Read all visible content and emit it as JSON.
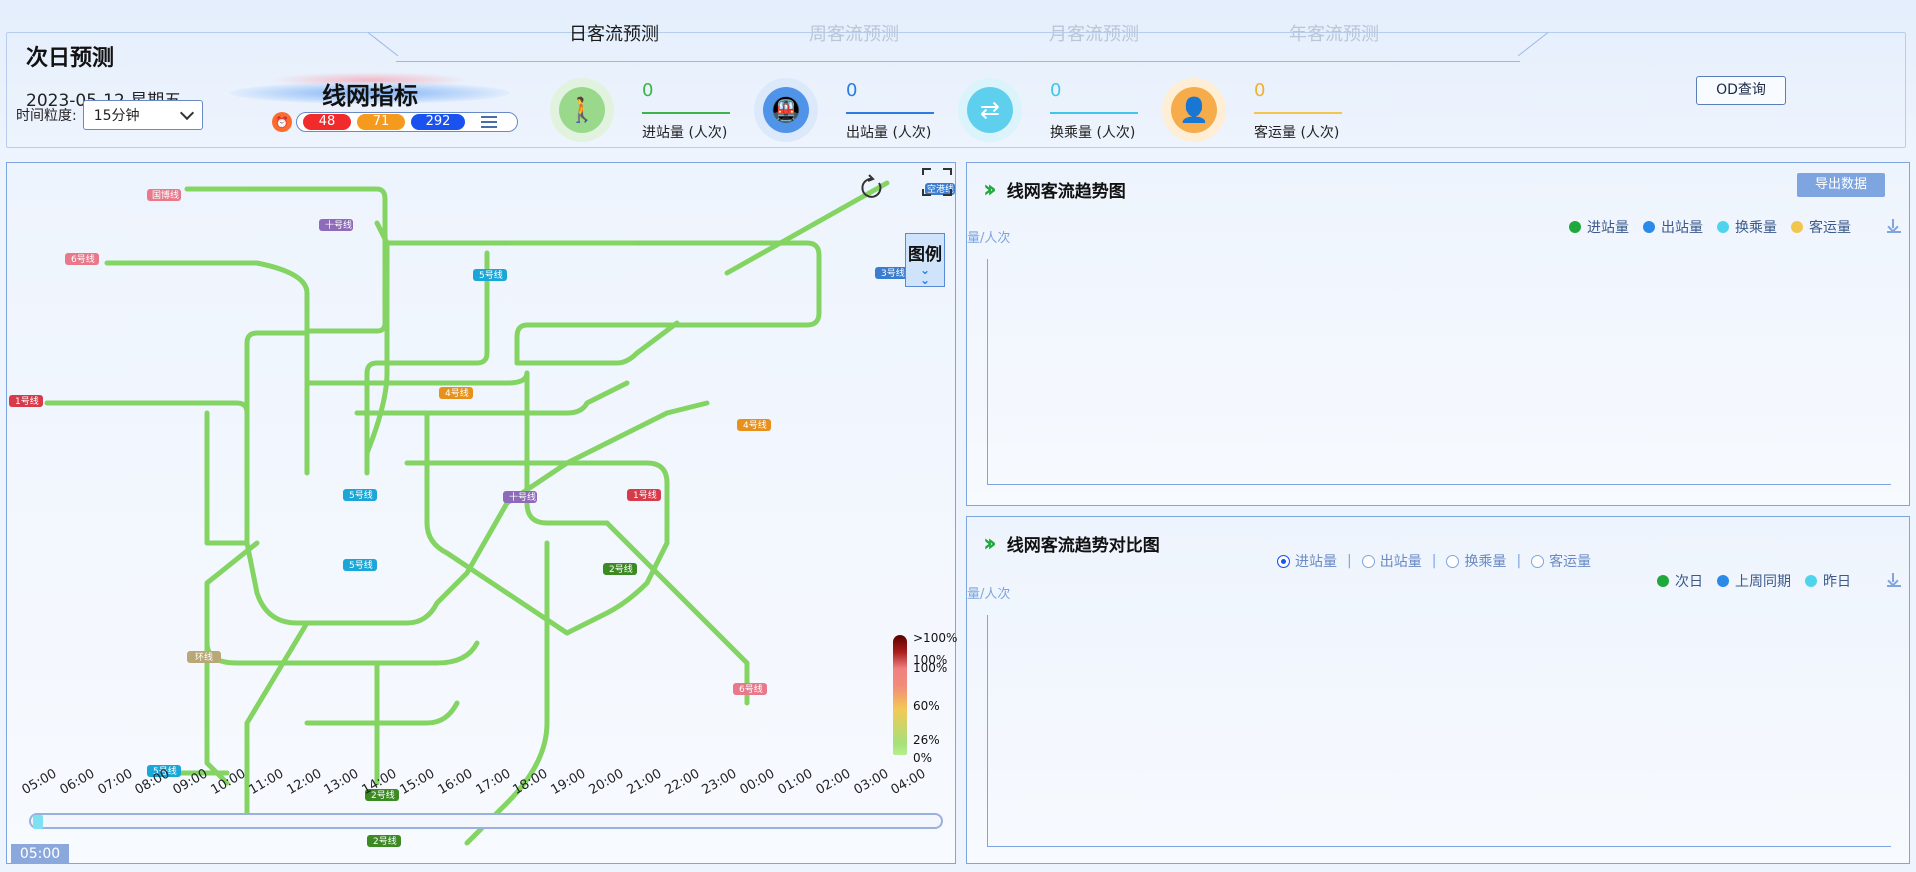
{
  "header": {
    "tabs": [
      {
        "label": "日客流预测",
        "active": true
      },
      {
        "label": "周客流预测",
        "active": false
      },
      {
        "label": "月客流预测",
        "active": false
      },
      {
        "label": "年客流预测",
        "active": false
      }
    ],
    "title": "次日预测",
    "date": "2023-05-12 星期五",
    "granularity_label": "时间粒度:",
    "granularity_value": "15分钟",
    "od_button": "OD查询"
  },
  "net_index": {
    "title": "线网指标",
    "badges": [
      {
        "value": "48",
        "color": "#f12b2b"
      },
      {
        "value": "71",
        "color": "#f59a1c"
      },
      {
        "value": "292",
        "color": "#1a52f0"
      }
    ]
  },
  "metrics": [
    {
      "value": "0",
      "label": "进站量 (人次)",
      "color": "#3bb44a",
      "icon": "walking-person-icon"
    },
    {
      "value": "0",
      "label": "出站量 (人次)",
      "color": "#2b7ce0",
      "icon": "train-icon"
    },
    {
      "value": "0",
      "label": "换乘量 (人次)",
      "color": "#3fc6ea",
      "icon": "transfer-arrows-icon"
    },
    {
      "value": "0",
      "label": "客运量 (人次)",
      "color": "#f2b12c",
      "icon": "person-icon"
    }
  ],
  "map": {
    "legend_button": "图例",
    "scale_labels": [
      ">100%",
      "100%",
      "100%",
      "60%",
      "26%",
      "0%"
    ],
    "time_ticks": [
      "05:00",
      "06:00",
      "07:00",
      "08:00",
      "09:00",
      "10:00",
      "11:00",
      "12:00",
      "13:00",
      "14:00",
      "15:00",
      "16:00",
      "17:00",
      "18:00",
      "19:00",
      "20:00",
      "21:00",
      "22:00",
      "23:00",
      "00:00",
      "01:00",
      "02:00",
      "03:00",
      "04:00"
    ],
    "current_time": "05:00",
    "line_tags": [
      {
        "label": "国博线",
        "color": "#e8788a"
      },
      {
        "label": "6号线",
        "color": "#e8788a"
      },
      {
        "label": "十号线",
        "color": "#8e6bb8"
      },
      {
        "label": "5号线",
        "color": "#1aa7d8"
      },
      {
        "label": "3号线",
        "color": "#3a7dd0"
      },
      {
        "label": "空港线",
        "color": "#3a7dd0"
      },
      {
        "label": "1号线",
        "color": "#d83a4a"
      },
      {
        "label": "4号线",
        "color": "#e8901c"
      },
      {
        "label": "4号线",
        "color": "#e8901c"
      },
      {
        "label": "5号线",
        "color": "#1aa7d8"
      },
      {
        "label": "十号线",
        "color": "#8e6bb8"
      },
      {
        "label": "1号线",
        "color": "#d83a4a"
      },
      {
        "label": "5号线",
        "color": "#1aa7d8"
      },
      {
        "label": "2号线",
        "color": "#3b8a22"
      },
      {
        "label": "环线",
        "color": "#b8a878"
      },
      {
        "label": "6号线",
        "color": "#e8788a"
      },
      {
        "label": "5号线",
        "color": "#1aa7d8"
      },
      {
        "label": "2号线",
        "color": "#3b8a22"
      },
      {
        "label": "2号线",
        "color": "#3b8a22"
      }
    ]
  },
  "trend": {
    "title": "线网客流趋势图",
    "export": "导出数据",
    "y_unit": "量/人次",
    "legend": [
      {
        "label": "进站量",
        "color": "#1fa83c"
      },
      {
        "label": "出站量",
        "color": "#2b8ae8"
      },
      {
        "label": "换乘量",
        "color": "#4fd4ee"
      },
      {
        "label": "客运量",
        "color": "#f2c64c"
      }
    ]
  },
  "compare": {
    "title": "线网客流趋势对比图",
    "y_unit": "量/人次",
    "radios": [
      {
        "label": "进站量",
        "checked": true
      },
      {
        "label": "出站量",
        "checked": false
      },
      {
        "label": "换乘量",
        "checked": false
      },
      {
        "label": "客运量",
        "checked": false
      }
    ],
    "legend": [
      {
        "label": "次日",
        "color": "#1fa83c"
      },
      {
        "label": "上周同期",
        "color": "#2b8ae8"
      },
      {
        "label": "昨日",
        "color": "#4fd4ee"
      }
    ]
  }
}
